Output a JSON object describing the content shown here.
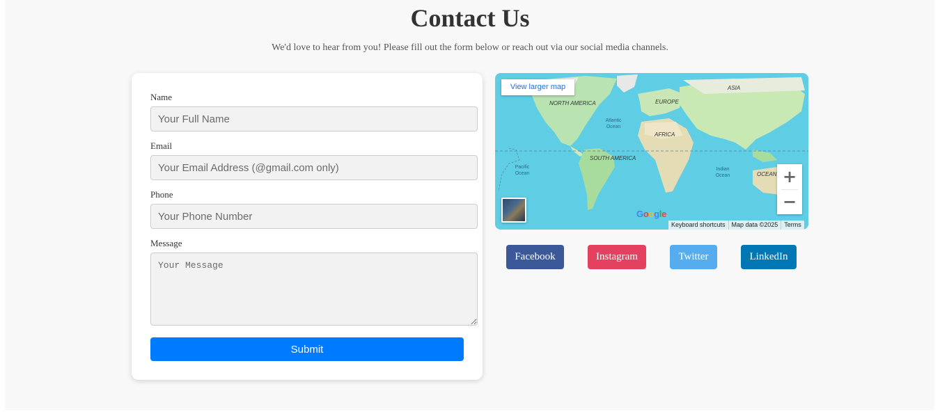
{
  "header": {
    "title": "Contact Us",
    "subtitle": "We'd love to hear from you! Please fill out the form below or reach out via our social media channels."
  },
  "form": {
    "name_label": "Name",
    "name_placeholder": "Your Full Name",
    "email_label": "Email",
    "email_placeholder": "Your Email Address (@gmail.com only)",
    "phone_label": "Phone",
    "phone_placeholder": "Your Phone Number",
    "message_label": "Message",
    "message_placeholder": "Your Message",
    "submit_label": "Submit"
  },
  "map": {
    "view_larger": "View larger map",
    "zoom_in": "+",
    "zoom_out": "−",
    "labels": {
      "north_america": "NORTH AMERICA",
      "south_america": "SOUTH AMERICA",
      "europe": "EUROPE",
      "asia": "ASIA",
      "africa": "AFRICA",
      "oceania": "OCEAN",
      "atlantic": "Atlantic Ocean",
      "pacific": "Pacific Ocean",
      "indian": "Indian Ocean"
    },
    "google": "Google",
    "footer": {
      "shortcuts": "Keyboard shortcuts",
      "data": "Map data ©2025",
      "terms": "Terms"
    }
  },
  "social": {
    "facebook": "Facebook",
    "instagram": "Instagram",
    "twitter": "Twitter",
    "linkedin": "LinkedIn"
  },
  "colors": {
    "facebook": "#3b5998",
    "instagram": "#e4405f",
    "twitter": "#55acee",
    "linkedin": "#0077b5",
    "submit": "#007bff"
  }
}
